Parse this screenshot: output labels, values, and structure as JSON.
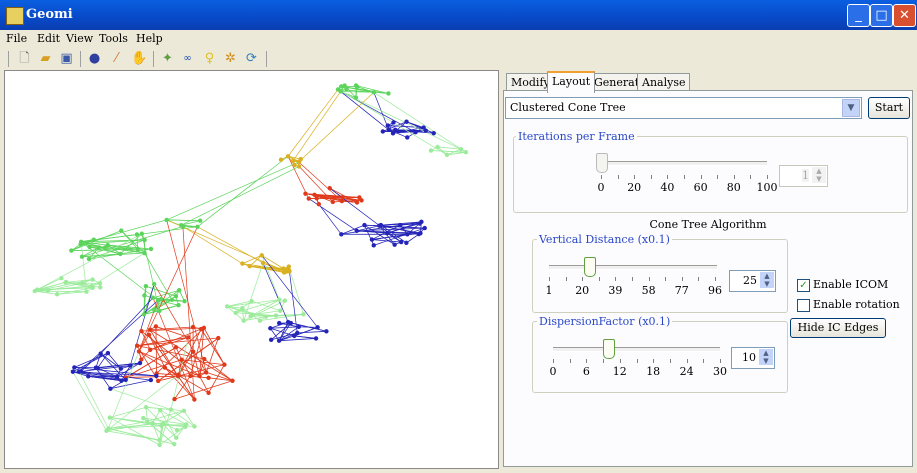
{
  "window": {
    "title": "Geomi"
  },
  "menu": [
    "File",
    "Edit",
    "View",
    "Tools",
    "Help"
  ],
  "toolbar_icons": [
    "new-file-icon",
    "open-folder-icon",
    "save-icon",
    "sphere-icon",
    "wand-icon",
    "hand-icon",
    "pointer-icon",
    "pattern-icon",
    "bulb-icon",
    "gear-icon",
    "refresh-icon"
  ],
  "tabs": [
    "Modify",
    "Layout",
    "Generate",
    "Analyse"
  ],
  "active_tab": "Layout",
  "layout": {
    "algorithm_select": "Clustered Cone Tree",
    "start_button": "Start",
    "iterations": {
      "label": "Iterations per Frame",
      "ticks": [
        "0",
        "20",
        "40",
        "60",
        "80",
        "100"
      ],
      "value": "1",
      "slider_fraction": 0.0
    },
    "cone_tree_title": "Cone Tree Algorithm",
    "vertical_distance": {
      "label": "Vertical Distance (x0.1)",
      "ticks": [
        "1",
        "20",
        "39",
        "58",
        "77",
        "96"
      ],
      "value": "25",
      "slider_fraction": 0.24
    },
    "dispersion": {
      "label": "DispersionFactor (x0.1)",
      "ticks": [
        "0",
        "6",
        "12",
        "18",
        "24",
        "30"
      ],
      "value": "10",
      "slider_fraction": 0.33
    },
    "enable_icom": "Enable ICOM",
    "enable_icom_checked": true,
    "enable_rotation": "Enable rotation",
    "enable_rotation_checked": false,
    "hide_ic_edges_button": "Hide IC Edges"
  },
  "colors": {
    "green": "#5cd45c",
    "lightgreen": "#9ceb9c",
    "blue": "#2424b8",
    "red": "#e03a1c",
    "yellow": "#d8b020",
    "titlebar": "#0849c8"
  }
}
